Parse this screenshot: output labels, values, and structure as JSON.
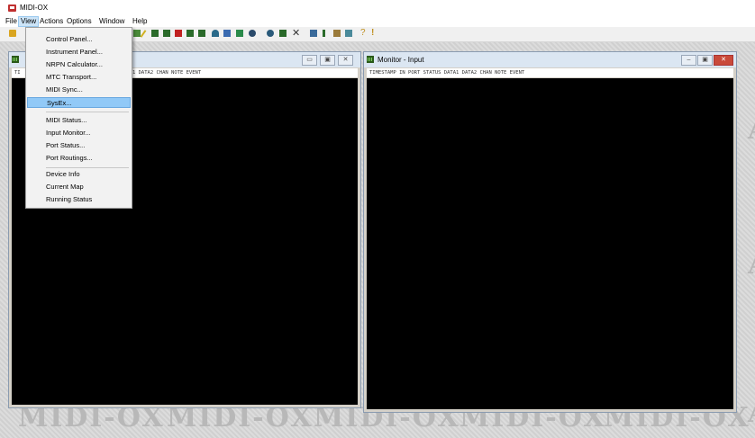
{
  "app": {
    "title": "MIDI-OX"
  },
  "menubar": {
    "items": [
      "File",
      "View",
      "Actions",
      "Options",
      "Window",
      "Help"
    ]
  },
  "view_menu": {
    "items": [
      "Control Panel...",
      "Instrument Panel...",
      "NRPN Calculator...",
      "MTC Transport...",
      "MIDI Sync...",
      "SysEx...",
      "MIDI Status...",
      "Input Monitor...",
      "Port Status...",
      "Port Routings...",
      "Device Info",
      "Current Map",
      "Running Status"
    ],
    "selected": "SysEx..."
  },
  "toolbar": {
    "extra_glyphs": [
      "?",
      "!"
    ]
  },
  "windows": {
    "left": {
      "header_text": "TI",
      "columns_text": "1 DATA2 CHAN NOTE EVENT",
      "buttons": [
        "▭",
        "▣",
        "✕"
      ]
    },
    "right": {
      "title": "Monitor - Input",
      "columns_text": "TIMESTAMP IN PORT STATUS DATA1 DATA2 CHAN NOTE EVENT",
      "buttons": [
        "–",
        "▣",
        "✕"
      ]
    }
  },
  "watermark": {
    "text": "MIDI-OX"
  }
}
